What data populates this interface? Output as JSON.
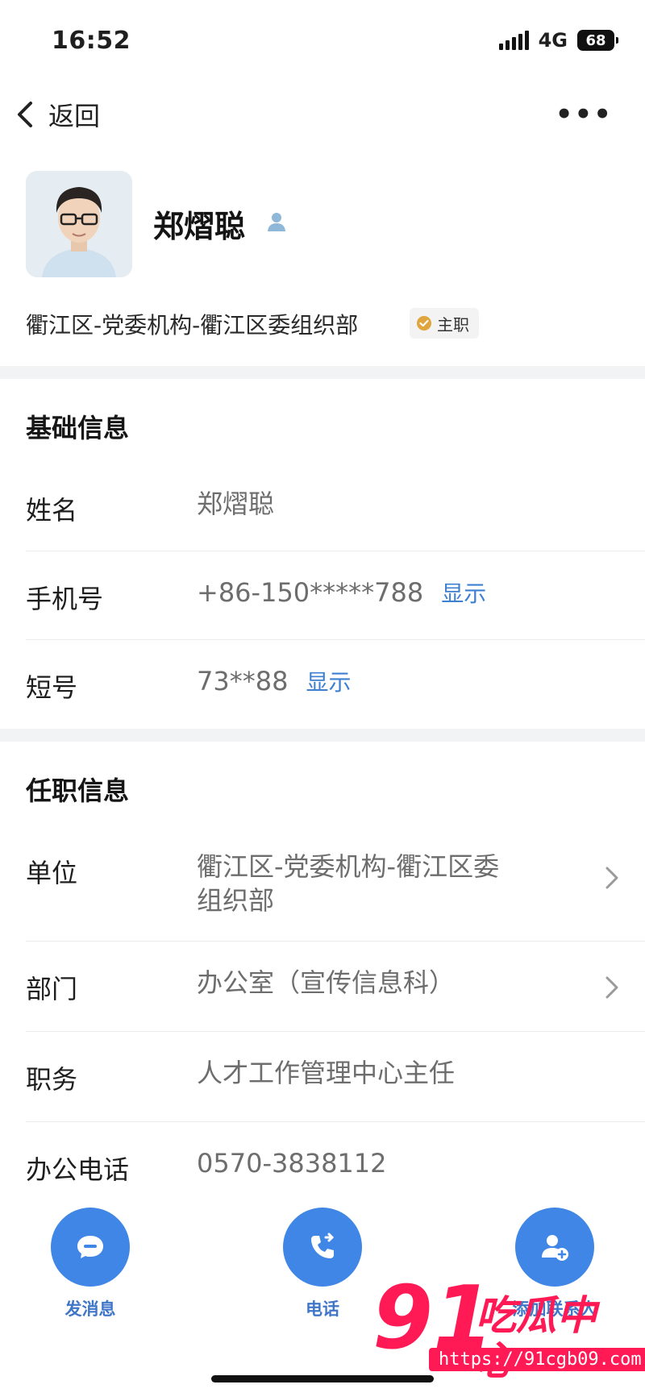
{
  "status_bar": {
    "time": "16:52",
    "network": "4G",
    "battery": "68"
  },
  "nav": {
    "back_label": "返回"
  },
  "profile": {
    "name": "郑熠聪",
    "organization": "衢江区-党委机构-衢江区委组织部",
    "badge": "主职"
  },
  "basic_info": {
    "title": "基础信息",
    "rows": [
      {
        "label": "姓名",
        "value": "郑熠聪"
      },
      {
        "label": "手机号",
        "value": "+86-150*****788",
        "link": "显示"
      },
      {
        "label": "短号",
        "value": "73**88",
        "link": "显示"
      }
    ]
  },
  "job_info": {
    "title": "任职信息",
    "rows": [
      {
        "label": "单位",
        "value_line1": "衢江区-党委机构-衢江区委",
        "value_line2": "组织部"
      },
      {
        "label": "部门",
        "value": "办公室（宣传信息科）"
      },
      {
        "label": "职务",
        "value": "人才工作管理中心主任"
      },
      {
        "label": "办公电话",
        "value": "0570-3838112"
      }
    ]
  },
  "actions": [
    {
      "label": "发消息",
      "icon": "message-icon"
    },
    {
      "label": "电话",
      "icon": "phone-icon"
    },
    {
      "label": "添加联系人",
      "icon": "add-contact-icon"
    }
  ],
  "watermark": {
    "number": "91",
    "text": "吃瓜中心",
    "url": "https://91cgb09.com"
  },
  "colors": {
    "accent": "#3f86e6",
    "link": "#3d7fd0",
    "watermark": "#ff1a55"
  }
}
